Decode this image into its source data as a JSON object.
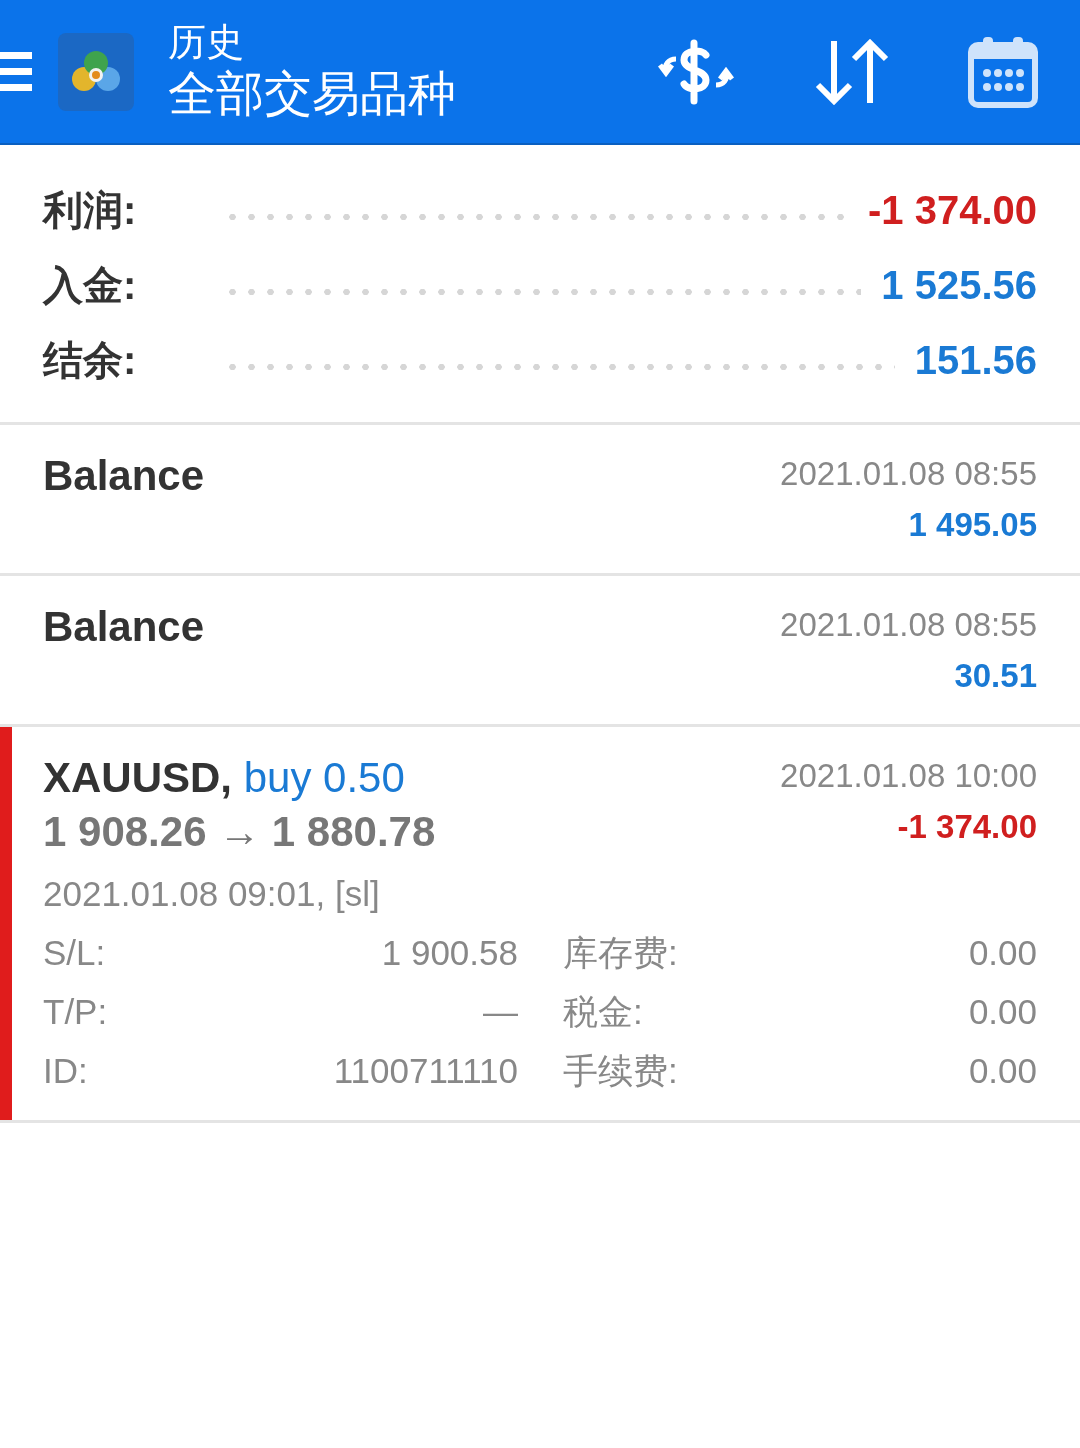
{
  "header": {
    "title": "历史",
    "subtitle": "全部交易品种"
  },
  "summary": [
    {
      "label": "利润:",
      "value": "-1 374.00",
      "kind": "loss"
    },
    {
      "label": "入金:",
      "value": "1 525.56",
      "kind": "profit"
    },
    {
      "label": "结余:",
      "value": "151.56",
      "kind": "profit"
    }
  ],
  "deals": [
    {
      "kind": "balance",
      "title": "Balance",
      "time": "2021.01.08 08:55",
      "amount": "1 495.05",
      "loss": false
    },
    {
      "kind": "balance",
      "title": "Balance",
      "time": "2021.01.08 08:55",
      "amount": "30.51",
      "loss": false
    },
    {
      "kind": "trade",
      "symbol": "XAUUSD,",
      "side": "buy 0.50",
      "prices": "1 908.26 → 1 880.78",
      "time": "2021.01.08 10:00",
      "amount": "-1 374.00",
      "loss": true,
      "open_info": "2021.01.08 09:01, [sl]",
      "details": [
        {
          "label": "S/L:",
          "value": "1 900.58",
          "label_2": "库存费:",
          "value_2": "0.00"
        },
        {
          "label": "T/P:",
          "value": "—",
          "label_2": "税金:",
          "value_2": "0.00"
        },
        {
          "label": "ID:",
          "value": "1100711110",
          "label_2": "手续费:",
          "value_2": "0.00"
        }
      ]
    }
  ]
}
